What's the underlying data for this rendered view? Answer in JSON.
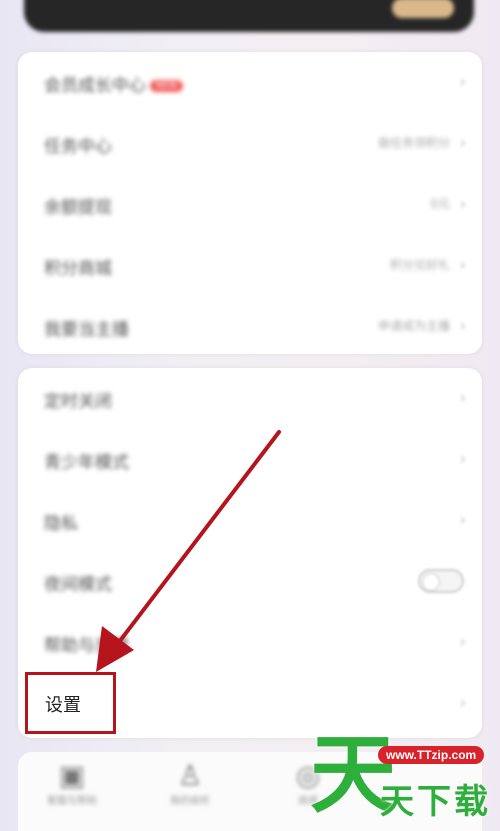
{
  "card_top": {
    "rows": [
      {
        "label": "会员成长中心",
        "badge": "NEW",
        "value": ""
      },
      {
        "label": "任务中心",
        "value": "做任务领积分"
      },
      {
        "label": "余额提现",
        "value": "0元"
      },
      {
        "label": "积分商城",
        "value": "积分兑好礼"
      },
      {
        "label": "我要当主播",
        "value": "申请成为主播"
      }
    ],
    "chevron": "›"
  },
  "card_bottom": {
    "rows": [
      {
        "label": "定时关闭"
      },
      {
        "label": "青少年模式"
      },
      {
        "label": "隐私"
      },
      {
        "label": "夜间模式"
      },
      {
        "label": "帮助与反馈"
      },
      {
        "label": "设置"
      }
    ],
    "chevron": "›"
  },
  "bottom_nav": [
    {
      "icon": "chat-icon",
      "label": "客服与帮助"
    },
    {
      "icon": "user-icon",
      "label": "我的收听"
    },
    {
      "icon": "shop-icon",
      "label": "商城"
    }
  ],
  "watermark": {
    "big": "天",
    "url": "www.TTzip.com",
    "text": "天下载"
  },
  "colors": {
    "highlight": "#b5141c",
    "arrow": "#b5141c",
    "watermark_green": "#2eae3a",
    "badge": "#f25b5b"
  }
}
